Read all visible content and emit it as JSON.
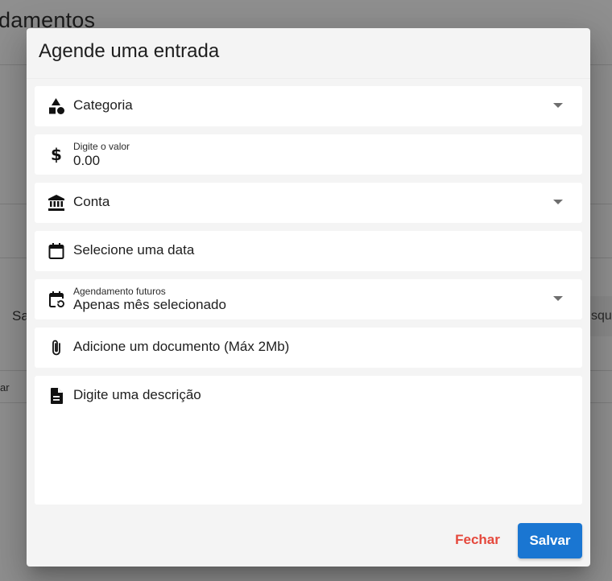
{
  "background": {
    "page_title": "damentos",
    "left_fragment_1": "Sa",
    "left_fragment_2": "ar",
    "right_fragment": "squ"
  },
  "dialog": {
    "title": "Agende uma entrada",
    "fields": {
      "category": {
        "label": "Categoria",
        "icon": "category-shapes-icon"
      },
      "amount": {
        "small_label": "Digite o valor",
        "value": "0.00",
        "icon": "dollar-icon"
      },
      "account": {
        "label": "Conta",
        "icon": "bank-icon"
      },
      "date": {
        "label": "Selecione uma data",
        "icon": "calendar-icon"
      },
      "future_schedule": {
        "small_label": "Agendamento futuros",
        "value": "Apenas mês selecionado",
        "icon": "calendar-repeat-icon"
      },
      "document": {
        "label": "Adicione um documento (Máx 2Mb)",
        "icon": "paperclip-icon"
      },
      "description": {
        "label": "Digite uma descrição",
        "icon": "document-icon"
      }
    },
    "actions": {
      "close_label": "Fechar",
      "save_label": "Salvar"
    }
  },
  "colors": {
    "overlay": "#8f8f8f",
    "primary": "#1a76d2",
    "danger": "#e5483c"
  }
}
